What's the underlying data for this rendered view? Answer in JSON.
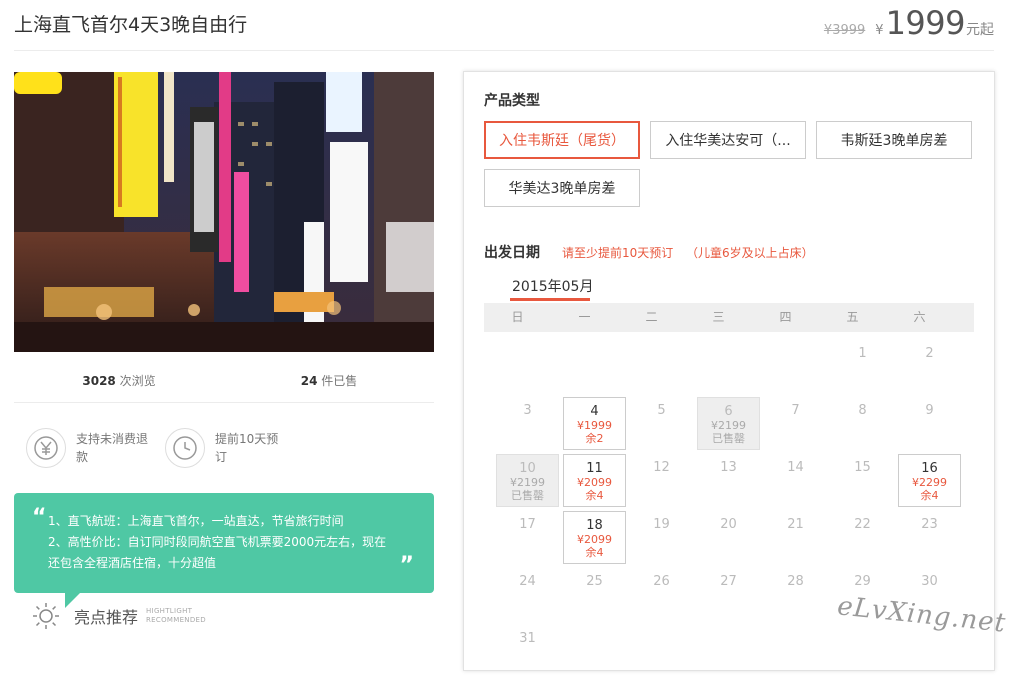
{
  "header": {
    "title": "上海直飞首尔4天3晚自由行",
    "old_price": "¥3999",
    "currency": "¥",
    "price": "1999",
    "price_suffix": "元起"
  },
  "stats": {
    "views_num": "3028",
    "views_label": "次浏览",
    "sold_num": "24",
    "sold_label": "件已售"
  },
  "features": [
    {
      "icon": "yen-refund-icon",
      "text": "支持未消费退款"
    },
    {
      "icon": "clock-icon",
      "text": "提前10天预订"
    }
  ],
  "highlight": {
    "lines": [
      "1、直飞航班：上海直飞首尔，一站直达，节省旅行时间",
      "2、高性价比：自订同时段同航空直飞机票要2000元左右，现在还包含全程酒店住宿，十分超值"
    ],
    "label": "亮点推荐",
    "en_line1": "HIGHTLIGHT",
    "en_line2": "RECOMMENDED"
  },
  "booking": {
    "product_type_title": "产品类型",
    "product_types": [
      "入住韦斯廷（尾货）",
      "入住华美达安可（...",
      "韦斯廷3晚单房差",
      "华美达3晚单房差"
    ],
    "selected_index": 0,
    "depart_title": "出发日期",
    "note1": "请至少提前10天预订",
    "note2": "（儿童6岁及以上占床）",
    "month": "2015年05月",
    "weekdays": [
      "日",
      "一",
      "二",
      "三",
      "四",
      "五",
      "六"
    ],
    "days": {
      "d1": "1",
      "d2": "2",
      "d3": "3",
      "d4": "4",
      "d5": "5",
      "d6": "6",
      "d7": "7",
      "d8": "8",
      "d9": "9",
      "d10": "10",
      "d11": "11",
      "d12": "12",
      "d13": "13",
      "d14": "14",
      "d15": "15",
      "d16": "16",
      "d17": "17",
      "d18": "18",
      "d19": "19",
      "d20": "20",
      "d21": "21",
      "d22": "22",
      "d23": "23",
      "d24": "24",
      "d25": "25",
      "d26": "26",
      "d27": "27",
      "d28": "28",
      "d29": "29",
      "d30": "30",
      "d31": "31"
    },
    "prices": {
      "d4": {
        "price": "¥1999",
        "remain": "余2"
      },
      "d6": {
        "price": "¥2199",
        "remain": "已售罄"
      },
      "d10": {
        "price": "¥2199",
        "remain": "已售罄"
      },
      "d11": {
        "price": "¥2099",
        "remain": "余4"
      },
      "d16": {
        "price": "¥2299",
        "remain": "余4"
      },
      "d18": {
        "price": "¥2099",
        "remain": "余4"
      }
    }
  },
  "watermark": "eLvXing.net",
  "colors": {
    "accent": "#e8583e",
    "teal": "#4fc8a4"
  }
}
